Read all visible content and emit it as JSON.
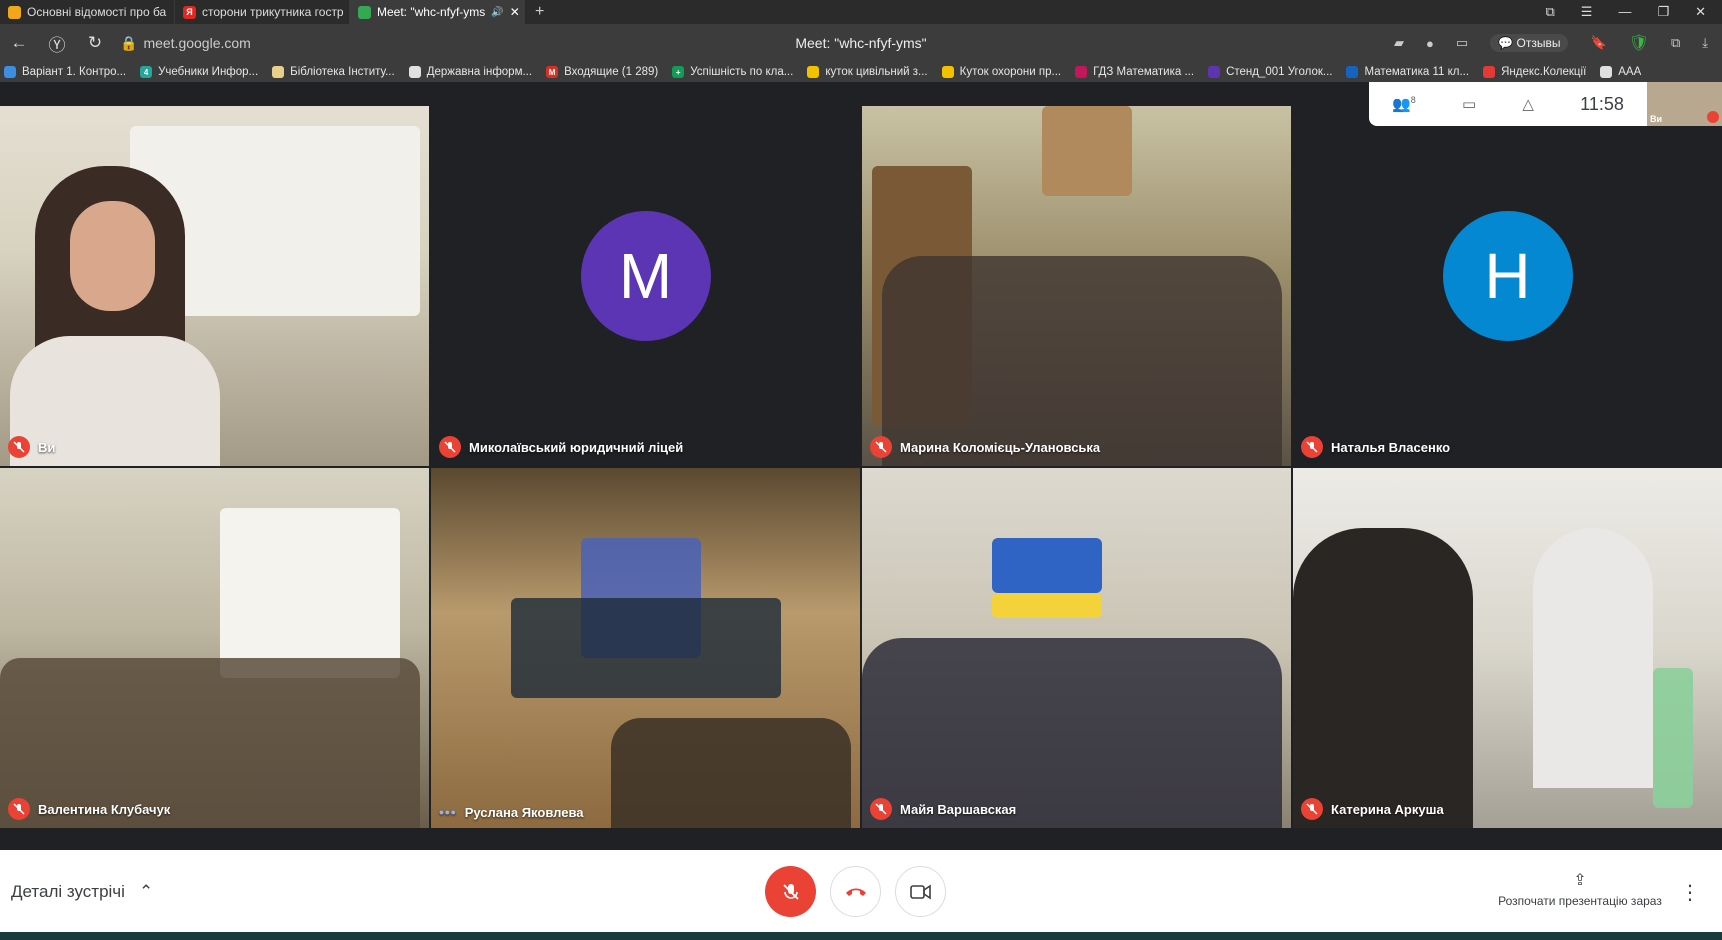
{
  "browser": {
    "tabs": [
      {
        "title": "Основні відомості про ба",
        "favicon_color": "#f2a71b"
      },
      {
        "title": "сторони трикутника гостр",
        "favicon_color": "#e52620"
      },
      {
        "title": "Meet: \"whc-nfyf-yms",
        "favicon_color": "#34a853",
        "active": true
      }
    ],
    "url": "meet.google.com",
    "page_title": "Meet: \"whc-nfyf-yms\"",
    "feedback_label": "Отзывы",
    "bookmarks": [
      "Варіант 1. Контро...",
      "Учебники Инфор...",
      "Бібліотека Інститу...",
      "Державна інформ...",
      "Входящие (1 289)",
      "Успішність по кла...",
      "куток цивільний з...",
      "Куток охорони пр...",
      "ГДЗ Математика ...",
      "Стенд_001 Уголок...",
      "Математика 11 кл...",
      "Яндекс.Колекції",
      "AAA"
    ]
  },
  "meet": {
    "people_count": "8",
    "clock": "11:58",
    "self_preview_label": "Ви",
    "participants": [
      {
        "name": "Ви",
        "mic": "muted",
        "video": true,
        "scene": "room1"
      },
      {
        "name": "Миколаївський юридичний ліцей",
        "mic": "muted",
        "video": false,
        "initial": "M",
        "avatar_color": "#5c35b5"
      },
      {
        "name": "Марина Коломієць-Улановська",
        "mic": "muted",
        "video": true,
        "scene": "room2"
      },
      {
        "name": "Наталья Власенко",
        "mic": "muted",
        "video": false,
        "initial": "Н",
        "avatar_color": "#0388d1"
      },
      {
        "name": "Валентина Клубачук",
        "mic": "muted",
        "video": true,
        "scene": "room3"
      },
      {
        "name": "Руслана Яковлева",
        "mic": "speaking",
        "video": true,
        "scene": "stage"
      },
      {
        "name": "Майя Варшавская",
        "mic": "muted",
        "video": true,
        "scene": "room4"
      },
      {
        "name": "Катерина Аркуша",
        "mic": "muted",
        "video": true,
        "scene": "room5"
      }
    ],
    "bottom": {
      "details_label": "Деталі зустрічі",
      "present_label": "Розпочати презентацію зараз"
    }
  },
  "colors": {
    "mute_red": "#ea4335",
    "meet_dark": "#202124"
  }
}
